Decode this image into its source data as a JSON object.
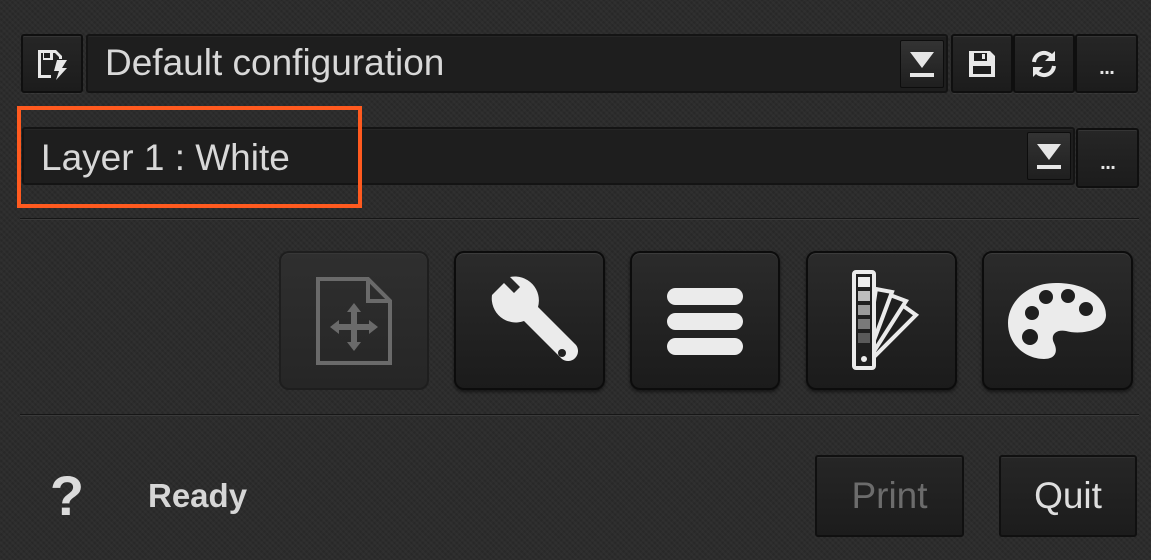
{
  "config": {
    "selected": "Default configuration",
    "more_label": "..."
  },
  "layer": {
    "selected": "Layer 1 : White",
    "more_label": "..."
  },
  "highlight_color": "#ff5a1f",
  "toolbar": {
    "tools": [
      {
        "name": "position-tool",
        "icon": "page-move-icon",
        "enabled": false
      },
      {
        "name": "settings-tool",
        "icon": "wrench-icon",
        "enabled": true
      },
      {
        "name": "list-tool",
        "icon": "stack-icon",
        "enabled": true
      },
      {
        "name": "swatch-tool",
        "icon": "color-swatch-fan-icon",
        "enabled": true
      },
      {
        "name": "palette-tool",
        "icon": "paint-palette-icon",
        "enabled": true
      }
    ]
  },
  "footer": {
    "help_label": "?",
    "status": "Ready",
    "print_label": "Print",
    "quit_label": "Quit"
  }
}
